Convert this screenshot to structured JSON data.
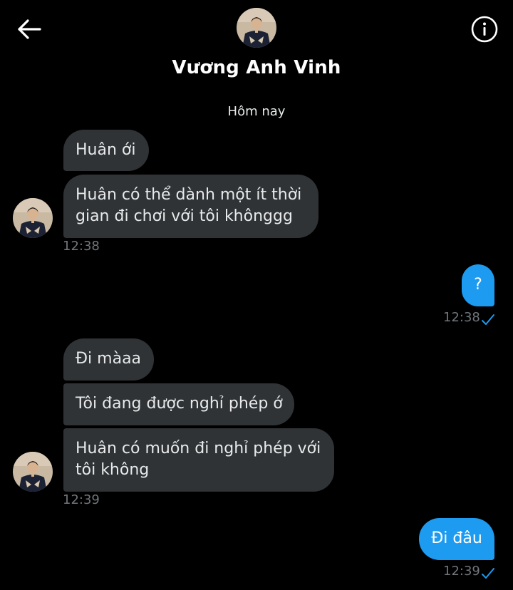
{
  "header": {
    "contact_name": "Vương Anh Vinh",
    "back_icon": "back-arrow-icon",
    "info_icon": "info-icon"
  },
  "conversation": {
    "date_separator": "Hôm nay",
    "group1": {
      "messages": [
        "Huân ới",
        "Huân có thể dành một ít thời",
        "gian đi chơi với tôi khônggg"
      ],
      "time": "12:38"
    },
    "outgoing1": {
      "message": "?",
      "time": "12:38"
    },
    "group2": {
      "messages": [
        "Đi màaa",
        "Tôi đang được nghỉ phép ớ",
        "Huân có muốn đi nghỉ phép với",
        "tôi không"
      ],
      "time": "12:39"
    },
    "outgoing2": {
      "message": "Đi đâu",
      "time": "12:39"
    }
  },
  "colors": {
    "background": "#000000",
    "incoming_bubble": "#2f3336",
    "outgoing_bubble": "#1d9bf0",
    "timestamp": "#71767b",
    "read_check": "#1d9bf0"
  }
}
